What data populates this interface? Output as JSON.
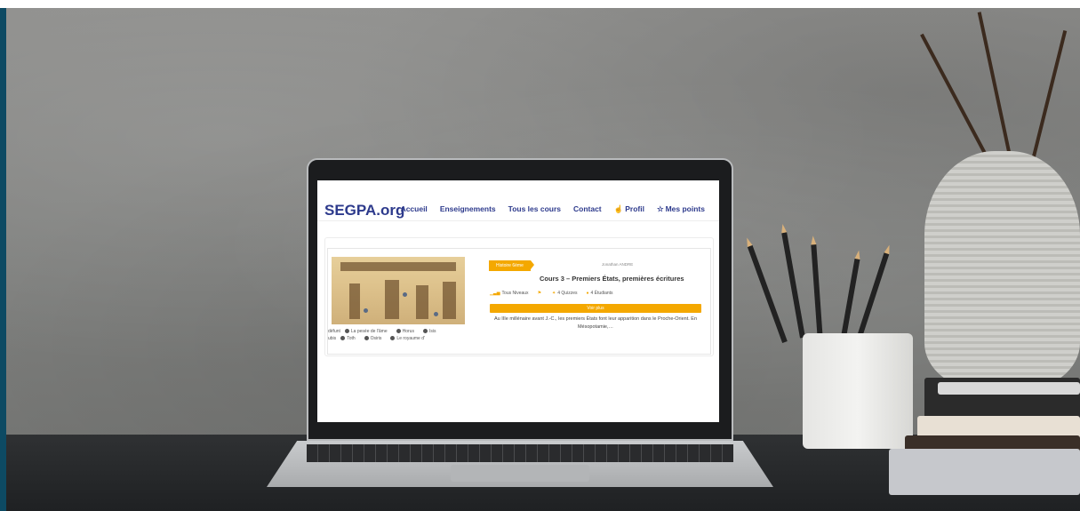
{
  "site": {
    "logo": "SEGPA.org",
    "nav": [
      {
        "label": "Accueil"
      },
      {
        "label": "Enseignements"
      },
      {
        "label": "Tous les cours"
      },
      {
        "label": "Contact"
      },
      {
        "label": "Profil",
        "icon": "hand-pointer-icon"
      },
      {
        "label": "Mes points",
        "icon": "star-icon"
      }
    ]
  },
  "course": {
    "category": "Histoire 6ème",
    "author": "Jonathan ANDRE",
    "title": "Cours 3 – Premiers États, premières écritures",
    "level": "Tous Niveaux",
    "quizzes": "4 Quizzes",
    "students": "4 Étudiants",
    "cta": "Voir plus",
    "excerpt": "Au IIIe millénaire avant J.-C., les premiers États font leur apparition dans le Proche-Orient. En Mésopotamie,…",
    "image_legend": [
      "défunt",
      "La pesée de l'âme",
      "Horus",
      "Isis",
      "ubis",
      "Toth",
      "Osiris",
      "Le royaume d'"
    ]
  },
  "colors": {
    "accent": "#f4a800",
    "brand": "#2d3a8c",
    "edge": "#0d4a63"
  }
}
